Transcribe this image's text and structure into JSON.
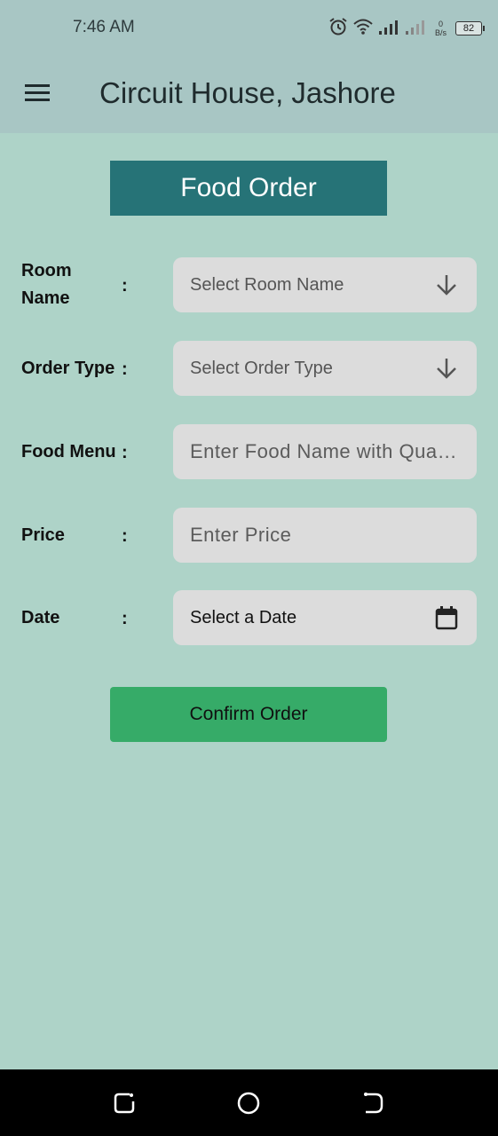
{
  "status_bar": {
    "time": "7:46 AM",
    "net_speed_value": "0",
    "net_speed_unit": "B/s",
    "battery_level": "82",
    "icons": [
      "alarm-icon",
      "wifi-icon",
      "signal-icon",
      "signal-icon",
      "battery-icon"
    ]
  },
  "app_bar": {
    "title": "Circuit House, Jashore",
    "menu_icon": "hamburger-menu-icon"
  },
  "form": {
    "title": "Food Order",
    "room": {
      "label": "Room Name",
      "colon": ":",
      "placeholder": "Select Room Name",
      "icon": "arrow-down-icon"
    },
    "order_type": {
      "label": "Order Type",
      "colon": ":",
      "placeholder": "Select Order Type",
      "icon": "arrow-down-icon"
    },
    "food_menu": {
      "label": "Food Menu",
      "colon": ":",
      "placeholder": "Enter Food Name with Quantity"
    },
    "price": {
      "label": "Price",
      "colon": ":",
      "placeholder": "Enter Price"
    },
    "date": {
      "label": "Date",
      "colon": ":",
      "value": "Select a Date",
      "icon": "calendar-icon"
    },
    "confirm_label": "Confirm Order"
  },
  "nav_bar": {
    "icons": [
      "recent-apps-icon",
      "home-icon",
      "back-icon"
    ]
  },
  "colors": {
    "background": "#aed3c8",
    "app_bar": "#a8c6c4",
    "title_bar": "#267377",
    "confirm_button": "#36ab68",
    "field": "#dcdcdc"
  }
}
